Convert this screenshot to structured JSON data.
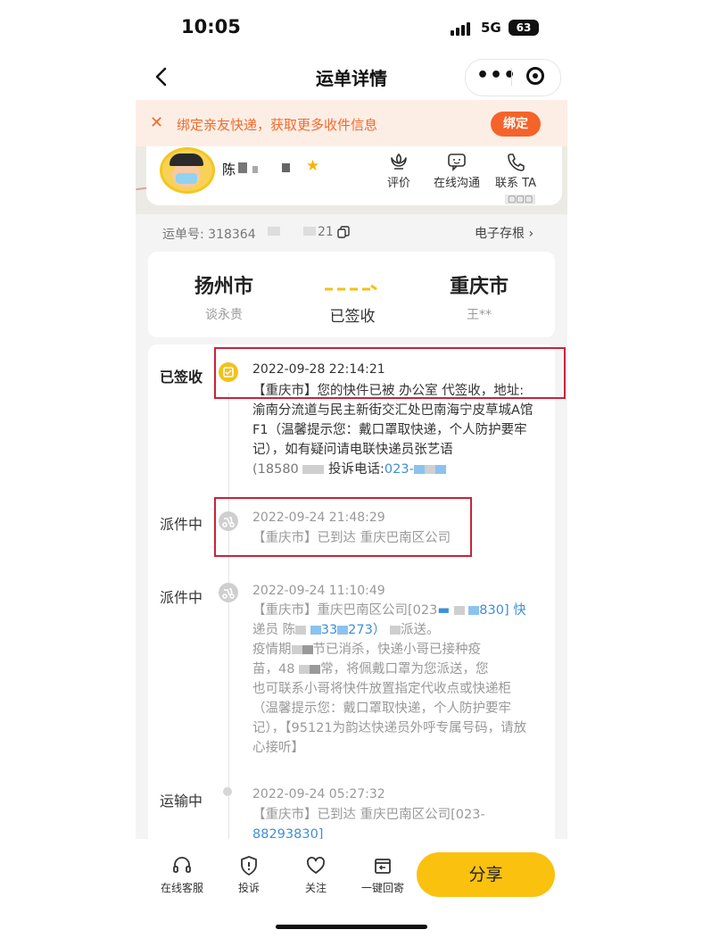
{
  "status_bar": {
    "time": "10:05",
    "network": "5G",
    "battery": "63"
  },
  "nav": {
    "title": "运单详情",
    "more_icon": "more-dots-icon",
    "capsule_icon": "record-target-icon"
  },
  "banner": {
    "text": "绑定亲友快递，获取更多收件信息",
    "button": "绑定"
  },
  "courier": {
    "name": "陈",
    "actions": [
      {
        "label": "评价",
        "icon": "flower-icon"
      },
      {
        "label": "在线沟通",
        "icon": "chat-icon"
      },
      {
        "label": "联系 TA",
        "icon": "phone-icon"
      }
    ]
  },
  "tracking": {
    "label": "运单号: 318364",
    "suffix": "21",
    "archive": "电子存根 ›"
  },
  "route": {
    "from_city": "扬州市",
    "from_person": "谈永贵",
    "to_city": "重庆市",
    "to_person": "王**",
    "status": "已签收"
  },
  "timeline": [
    {
      "stage": "已签收",
      "time": "2022-09-28 22:14:21",
      "desc_lines": [
        "【重庆市】您的快件已被 办公室 代签收，地址:",
        "渝南分流道与民主新街交汇处巴南海宁皮草城A馆",
        "F1（温馨提示您：戴口罩取快递，个人防护要牢",
        "记），如有疑问请电联快递员张艺语"
      ],
      "phone_prefix": "(18580",
      "phone_mid": "投诉电话:",
      "phone_link": "023-"
    },
    {
      "stage": "派件中",
      "time": "2022-09-24 21:48:29",
      "desc_lines": [
        "【重庆市】已到达 重庆巴南区公司"
      ]
    },
    {
      "stage": "派件中",
      "time": "2022-09-24 11:10:49",
      "desc_lines": [
        "【重庆市】重庆巴南区公司[023",
        "830] 快",
        "递员 陈",
        "33",
        "273）",
        "派送。",
        "疫情期",
        "节已消杀，快递小哥已接种疫",
        "苗，48",
        "常，将佩戴口罩为您派送，您",
        "也可联系小哥将快件放置指定代收点或快递柜",
        "（温馨提示您：戴口罩取快递，个人防护要牢",
        "记），【95121为韵达快递员外呼专属号码，请放",
        "心接听】"
      ]
    },
    {
      "stage": "运输中",
      "time": "2022-09-24 05:27:32",
      "desc_lines": [
        "【重庆市】已到达 重庆巴南区公司[023-",
        "88293830]"
      ]
    }
  ],
  "bottom_bar": {
    "items": [
      {
        "label": "在线客服",
        "icon": "headset-icon"
      },
      {
        "label": "投诉",
        "icon": "shield-alert-icon"
      },
      {
        "label": "关注",
        "icon": "heart-icon"
      },
      {
        "label": "一键回寄",
        "icon": "return-box-icon"
      }
    ],
    "share": "分享"
  },
  "colors": {
    "accent_orange": "#f5632a",
    "yellow": "#fac10f",
    "link_blue": "#3d8fd8",
    "annotation_red": "#c8243b"
  }
}
